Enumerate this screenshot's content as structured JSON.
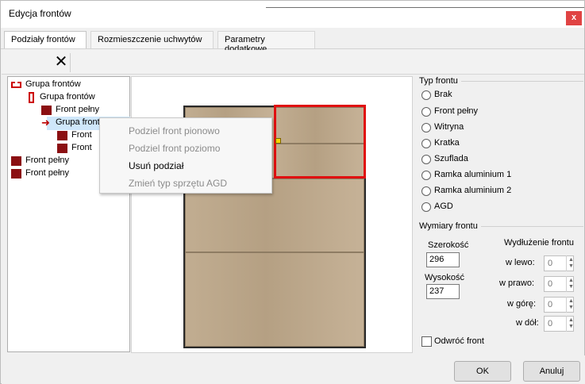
{
  "window": {
    "title": "Edycja frontów",
    "close_glyph": "x"
  },
  "tabs": [
    {
      "label": "Podziały frontów",
      "active": true
    },
    {
      "label": "Rozmieszczenie uchwytów",
      "active": false
    },
    {
      "label": "Parametry dodatkowe",
      "active": false
    }
  ],
  "toolbar": {
    "delete_glyph": "✕"
  },
  "tree": {
    "items": [
      {
        "label": "Grupa frontów",
        "icon": "group-stripe-icon"
      },
      {
        "label": "Grupa frontów",
        "icon": "group-vertical-icon"
      },
      {
        "label": "Front pełny",
        "icon": "front-solid-icon"
      },
      {
        "label": "Grupa fronto",
        "icon": "arrow-right-icon",
        "selected": true
      },
      {
        "label": "Front",
        "icon": "front-solid-icon"
      },
      {
        "label": "Front",
        "icon": "front-solid-icon"
      },
      {
        "label": "Front pełny",
        "icon": "front-solid-icon"
      },
      {
        "label": "Front pełny",
        "icon": "front-solid-icon"
      }
    ]
  },
  "context_menu": {
    "items": [
      {
        "label": "Podziel front pionowo",
        "enabled": false
      },
      {
        "label": "Podziel front poziomo",
        "enabled": false
      },
      {
        "label": "Usuń podział",
        "enabled": true
      },
      {
        "label": "Zmień typ sprzętu AGD",
        "enabled": false
      }
    ]
  },
  "front_type": {
    "label": "Typ frontu",
    "options": [
      "Brak",
      "Front pełny",
      "Witryna",
      "Kratka",
      "Szuflada",
      "Ramka aluminium 1",
      "Ramka aluminium 2",
      "AGD"
    ]
  },
  "dimensions": {
    "label": "Wymiary frontu",
    "width_label": "Szerokość",
    "width_value": "296",
    "height_label": "Wysokość",
    "height_value": "237",
    "extension_label": "Wydłużenie frontu",
    "left_label": "w lewo:",
    "left_value": "0",
    "right_label": "w prawo:",
    "right_value": "0",
    "top_label": "w górę:",
    "top_value": "0",
    "bottom_label": "w dół:",
    "bottom_value": "0"
  },
  "reverse": {
    "label": "Odwróć front",
    "checked": false
  },
  "buttons": {
    "ok": "OK",
    "cancel": "Anuluj"
  },
  "colors": {
    "selection": "#e01010",
    "tree_icon": "#8b0f12",
    "tree_selection": "#cfe7fb"
  }
}
